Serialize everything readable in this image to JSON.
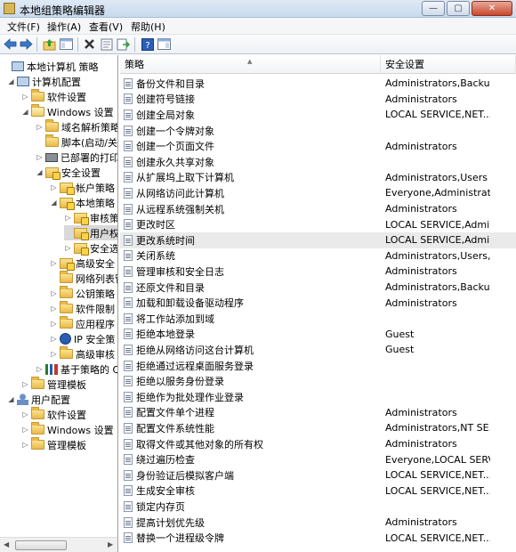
{
  "window": {
    "title": "本地组策略编辑器",
    "minimize_label": "—",
    "maximize_label": "▢",
    "close_label": "✕"
  },
  "menu": [
    "文件(F)",
    "操作(A)",
    "查看(V)",
    "帮助(H)"
  ],
  "toolbar": {
    "icons": [
      "back-arrow-icon",
      "forward-arrow-icon",
      "up-folder-icon",
      "show-hide-tree-icon",
      "delete-icon",
      "properties-icon",
      "export-list-icon",
      "help-icon",
      "show-hide-action-pane-icon"
    ]
  },
  "tree": [
    {
      "label": "本地计算机 策略",
      "icon": "computer-icon",
      "expand": ""
    },
    {
      "label": "计算机配置",
      "icon": "computer-icon",
      "expand": "◢"
    },
    {
      "label": "软件设置",
      "icon": "folder-icon",
      "expand": "▷"
    },
    {
      "label": "Windows 设置",
      "icon": "folder-icon",
      "expand": "◢"
    },
    {
      "label": "域名解析策略",
      "icon": "folder-icon",
      "expand": "▷"
    },
    {
      "label": "脚本(启动/关",
      "icon": "script-icon",
      "expand": ""
    },
    {
      "label": "已部署的打印",
      "icon": "printer-icon",
      "expand": "▷"
    },
    {
      "label": "安全设置",
      "icon": "security-folder-icon",
      "expand": "◢"
    },
    {
      "label": "帐户策略",
      "icon": "security-folder-icon",
      "expand": "▷"
    },
    {
      "label": "本地策略",
      "icon": "security-folder-icon",
      "expand": "◢"
    },
    {
      "label": "审核策",
      "icon": "security-folder-icon",
      "expand": "▷"
    },
    {
      "label": "用户权",
      "icon": "security-folder-icon",
      "expand": ""
    },
    {
      "label": "安全选",
      "icon": "security-folder-icon",
      "expand": "▷"
    },
    {
      "label": "高级安全",
      "icon": "security-folder-icon",
      "expand": "▷"
    },
    {
      "label": "网络列表管",
      "icon": "folder-icon",
      "expand": ""
    },
    {
      "label": "公钥策略",
      "icon": "folder-icon",
      "expand": "▷"
    },
    {
      "label": "软件限制",
      "icon": "folder-icon",
      "expand": "▷"
    },
    {
      "label": "应用程序",
      "icon": "folder-icon",
      "expand": "▷"
    },
    {
      "label": "IP 安全策",
      "icon": "ip-security-icon",
      "expand": "▷"
    },
    {
      "label": "高级审核",
      "icon": "folder-icon",
      "expand": "▷"
    },
    {
      "label": "基于策略的 Q",
      "icon": "chart-icon",
      "expand": "▷"
    },
    {
      "label": "管理模板",
      "icon": "folder-icon",
      "expand": "▷"
    },
    {
      "label": "用户配置",
      "icon": "user-icon",
      "expand": "◢"
    },
    {
      "label": "软件设置",
      "icon": "folder-icon",
      "expand": "▷"
    },
    {
      "label": "Windows 设置",
      "icon": "folder-icon",
      "expand": "▷"
    },
    {
      "label": "管理模板",
      "icon": "folder-icon",
      "expand": "▷"
    }
  ],
  "list": {
    "columns": [
      "策略",
      "安全设置"
    ],
    "rows": [
      {
        "policy": "备份文件和目录",
        "setting": "Administrators,Backu..."
      },
      {
        "policy": "创建符号链接",
        "setting": "Administrators"
      },
      {
        "policy": "创建全局对象",
        "setting": "LOCAL SERVICE,NET..."
      },
      {
        "policy": "创建一个令牌对象",
        "setting": ""
      },
      {
        "policy": "创建一个页面文件",
        "setting": "Administrators"
      },
      {
        "policy": "创建永久共享对象",
        "setting": ""
      },
      {
        "policy": "从扩展坞上取下计算机",
        "setting": "Administrators,Users"
      },
      {
        "policy": "从网络访问此计算机",
        "setting": "Everyone,Administrat..."
      },
      {
        "policy": "从远程系统强制关机",
        "setting": "Administrators"
      },
      {
        "policy": "更改时区",
        "setting": "LOCAL SERVICE,Admi..."
      },
      {
        "policy": "更改系统时间",
        "setting": "LOCAL SERVICE,Admi..."
      },
      {
        "policy": "关闭系统",
        "setting": "Administrators,Users,..."
      },
      {
        "policy": "管理审核和安全日志",
        "setting": "Administrators"
      },
      {
        "policy": "还原文件和目录",
        "setting": "Administrators,Backu..."
      },
      {
        "policy": "加载和卸载设备驱动程序",
        "setting": "Administrators"
      },
      {
        "policy": "将工作站添加到域",
        "setting": ""
      },
      {
        "policy": "拒绝本地登录",
        "setting": "Guest"
      },
      {
        "policy": "拒绝从网络访问这台计算机",
        "setting": "Guest"
      },
      {
        "policy": "拒绝通过远程桌面服务登录",
        "setting": ""
      },
      {
        "policy": "拒绝以服务身份登录",
        "setting": ""
      },
      {
        "policy": "拒绝作为批处理作业登录",
        "setting": ""
      },
      {
        "policy": "配置文件单个进程",
        "setting": "Administrators"
      },
      {
        "policy": "配置文件系统性能",
        "setting": "Administrators,NT SE..."
      },
      {
        "policy": "取得文件或其他对象的所有权",
        "setting": "Administrators"
      },
      {
        "policy": "绕过遍历检查",
        "setting": "Everyone,LOCAL SERV..."
      },
      {
        "policy": "身份验证后模拟客户端",
        "setting": "LOCAL SERVICE,NET..."
      },
      {
        "policy": "生成安全审核",
        "setting": "LOCAL SERVICE,NET..."
      },
      {
        "policy": "锁定内存页",
        "setting": ""
      },
      {
        "policy": "提高计划优先级",
        "setting": "Administrators"
      },
      {
        "policy": "替换一个进程级令牌",
        "setting": "LOCAL SERVICE,NET..."
      }
    ],
    "selected_policy": "更改系统时间"
  }
}
